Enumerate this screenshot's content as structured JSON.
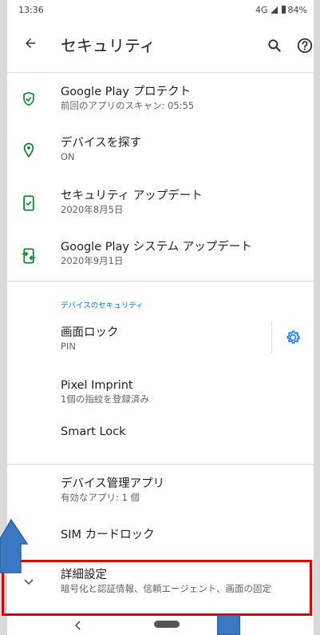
{
  "status_bar": {
    "time": "13:36",
    "network": "4G",
    "battery": "84%"
  },
  "toolbar": {
    "title": "セキュリティ",
    "back_icon": "arrow-back-icon",
    "search_icon": "search-icon",
    "help_icon": "help-icon"
  },
  "status_items": [
    {
      "title": "Google Play プロテクト",
      "subtitle": "前回のアプリのスキャン: 05:55",
      "icon": "shield-check-icon"
    },
    {
      "title": "デバイスを探す",
      "subtitle": "ON",
      "icon": "location-pin-icon"
    },
    {
      "title": "セキュリティ アップデート",
      "subtitle": "2020年8月5日",
      "icon": "phone-update-icon"
    },
    {
      "title": "Google Play システム アップデート",
      "subtitle": "2020年9月1日",
      "icon": "phone-sync-icon"
    }
  ],
  "device_security": {
    "category": "デバイスのセキュリティ",
    "screen_lock": {
      "title": "画面ロック",
      "subtitle": "PIN",
      "gear_icon": "gear-icon"
    },
    "pixel_imprint": {
      "title": "Pixel Imprint",
      "subtitle": "1個の指紋を登録済み"
    },
    "smart_lock": {
      "title": "Smart Lock"
    }
  },
  "other_items": {
    "device_admin": {
      "title": "デバイス管理アプリ",
      "subtitle": "有効なアプリ: 1 個"
    },
    "sim_lock": {
      "title": "SIM カードロック"
    },
    "advanced": {
      "title": "詳細設定",
      "subtitle": "暗号化と認証情報、信頼エージェント、画面の固定",
      "icon": "chevron-down-icon"
    }
  },
  "nav_bar": {
    "back_icon": "nav-back-icon",
    "home_icon": "nav-home-pill-icon"
  },
  "colors": {
    "accent_green": "#188038",
    "accent_blue": "#1a73e8",
    "highlight_red": "#e00000",
    "annotation_blue": "#3a78c2"
  }
}
